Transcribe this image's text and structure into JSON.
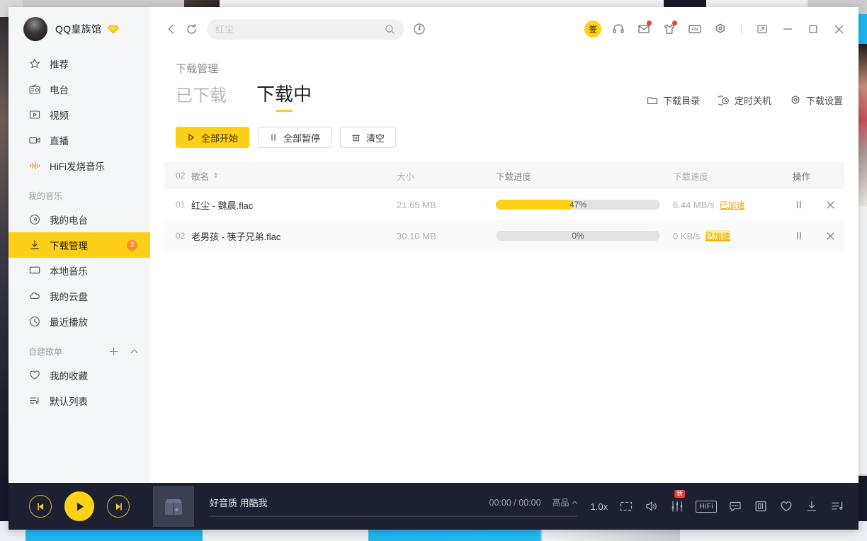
{
  "window": {
    "title": "下载管理"
  },
  "sidebar": {
    "user": {
      "name": "QQ皇族馆",
      "vip_icon": "vip-diamond-icon"
    },
    "items": [
      {
        "label": "推荐",
        "icon": "star-icon"
      },
      {
        "label": "电台",
        "icon": "radio-icon"
      },
      {
        "label": "视频",
        "icon": "video-icon"
      },
      {
        "label": "直播",
        "icon": "live-icon"
      },
      {
        "label": "HiFi发烧音乐",
        "icon": "hifi-wave-icon"
      }
    ],
    "my_music_title": "我的音乐",
    "my_music_items": [
      {
        "label": "我的电台",
        "icon": "my-radio-icon",
        "badge": ""
      },
      {
        "label": "下载管理",
        "icon": "download-icon",
        "badge": "2",
        "active": true
      },
      {
        "label": "本地音乐",
        "icon": "monitor-icon",
        "badge": ""
      },
      {
        "label": "我的云盘",
        "icon": "cloud-icon",
        "badge": ""
      },
      {
        "label": "最近播放",
        "icon": "clock-icon",
        "badge": ""
      }
    ],
    "playlist_title": "自建歌单",
    "playlist_items": [
      {
        "label": "我的收藏",
        "icon": "heart-icon"
      },
      {
        "label": "默认列表",
        "icon": "playlist-icon"
      }
    ]
  },
  "toolbar": {
    "back_icon": "back-arrow-icon",
    "refresh_icon": "refresh-icon",
    "search_value": "红尘",
    "search_placeholder": "红尘",
    "search_icon": "search-icon",
    "disc_icon": "music-disc-icon",
    "sign_in_label": "签",
    "icons": [
      {
        "name": "headphones-icon",
        "dot": false
      },
      {
        "name": "mail-icon",
        "dot": true
      },
      {
        "name": "skin-icon",
        "dot": true
      },
      {
        "name": "fm-icon",
        "dot": false
      },
      {
        "name": "settings-icon",
        "dot": false
      }
    ],
    "mini_icon": "mini-mode-icon",
    "minimize_icon": "minimize-icon",
    "maximize_icon": "maximize-icon",
    "close_icon": "close-icon"
  },
  "page": {
    "title": "下载管理",
    "tabs": [
      {
        "label": "已下载",
        "active": false
      },
      {
        "label": "下载中",
        "active": true
      }
    ],
    "header_actions": [
      {
        "label": "下载目录",
        "icon": "folder-icon"
      },
      {
        "label": "定时关机",
        "icon": "timer-icon"
      },
      {
        "label": "下载设置",
        "icon": "gear-icon"
      }
    ],
    "controls": [
      {
        "label": "全部开始",
        "icon": "play-icon",
        "primary": true
      },
      {
        "label": "全部暂停",
        "icon": "pause-icon",
        "primary": false
      },
      {
        "label": "清空",
        "icon": "trash-icon",
        "primary": false
      }
    ]
  },
  "table": {
    "headers": {
      "count": "02",
      "name": "歌名",
      "size": "大小",
      "progress": "下载进度",
      "speed": "下载速度",
      "action": "操作"
    },
    "rows": [
      {
        "index": "01",
        "name": "红尘 - 魏晨.flac",
        "size": "21.65 MB",
        "percent": 47,
        "percent_label": "47%",
        "speed": "6.44 MB/s",
        "accel_label": "已加速",
        "accel_highlight": false,
        "pause_icon": "pause-icon",
        "remove_icon": "close-icon"
      },
      {
        "index": "02",
        "name": "老男孩 - 筷子兄弟.flac",
        "size": "30.10 MB",
        "percent": 0,
        "percent_label": "0%",
        "speed": "0 KB/s",
        "accel_label": "已加速",
        "accel_highlight": true,
        "pause_icon": "pause-icon",
        "remove_icon": "close-icon"
      }
    ]
  },
  "player": {
    "prev_icon": "previous-track-icon",
    "play_icon": "play-icon",
    "next_icon": "next-track-icon",
    "cover_icon": "album-cover-placeholder",
    "now_playing": "好音质 用酷我",
    "time": "00:00 / 00:00",
    "quality": "高品",
    "quality_caret": "caret-up-icon",
    "speed": "1.0x",
    "icons": [
      {
        "name": "desktop-lyrics-icon",
        "label": ""
      },
      {
        "name": "volume-icon",
        "label": ""
      },
      {
        "name": "equalizer-icon",
        "label": "",
        "badge": "新"
      },
      {
        "name": "hifi-icon",
        "label": "HiFi"
      },
      {
        "name": "comment-icon",
        "label": ""
      },
      {
        "name": "lyrics-icon",
        "label": "词"
      },
      {
        "name": "favorite-icon",
        "label": ""
      },
      {
        "name": "download-icon",
        "label": ""
      },
      {
        "name": "playlist-icon",
        "label": ""
      }
    ]
  },
  "colors": {
    "accent": "#ffcf17",
    "accent_fill": "#ffd217",
    "badge_orange": "#ff8a1f",
    "player_bg": "#1d2030",
    "accel_link": "#f0a300",
    "red_dot": "#f5393d"
  }
}
